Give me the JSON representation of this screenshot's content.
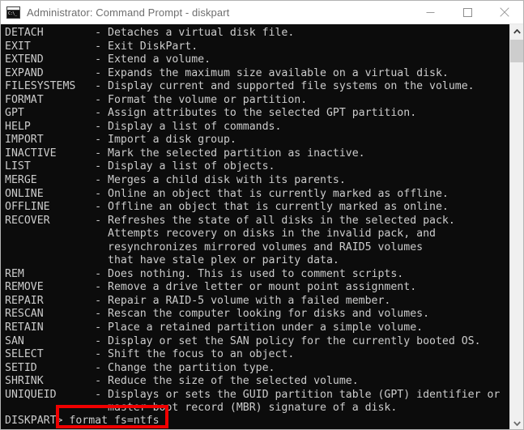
{
  "window": {
    "title": "Administrator: Command Prompt - diskpart",
    "icon": "command-prompt-icon",
    "icon_glyph": "C:\\_",
    "background_color": "#0c0c0c",
    "text_color": "#cccccc",
    "titlebar_color": "#ffffff"
  },
  "titlebar": {
    "minimize_label": "Minimize",
    "maximize_label": "Maximize",
    "close_label": "Close"
  },
  "console": {
    "body": "DETACH        - Detaches a virtual disk file.\nEXIT          - Exit DiskPart.\nEXTEND        - Extend a volume.\nEXPAND        - Expands the maximum size available on a virtual disk.\nFILESYSTEMS   - Display current and supported file systems on the volume.\nFORMAT        - Format the volume or partition.\nGPT           - Assign attributes to the selected GPT partition.\nHELP          - Display a list of commands.\nIMPORT        - Import a disk group.\nINACTIVE      - Mark the selected partition as inactive.\nLIST          - Display a list of objects.\nMERGE         - Merges a child disk with its parents.\nONLINE        - Online an object that is currently marked as offline.\nOFFLINE       - Offline an object that is currently marked as online.\nRECOVER       - Refreshes the state of all disks in the selected pack.\n                Attempts recovery on disks in the invalid pack, and\n                resynchronizes mirrored volumes and RAID5 volumes\n                that have stale plex or parity data.\nREM           - Does nothing. This is used to comment scripts.\nREMOVE        - Remove a drive letter or mount point assignment.\nREPAIR        - Repair a RAID-5 volume with a failed member.\nRESCAN        - Rescan the computer looking for disks and volumes.\nRETAIN        - Place a retained partition under a simple volume.\nSAN           - Display or set the SAN policy for the currently booted OS.\nSELECT        - Shift the focus to an object.\nSETID         - Change the partition type.\nSHRINK        - Reduce the size of the selected volume.\nUNIQUEID      - Displays or sets the GUID partition table (GPT) identifier or\n                master boot record (MBR) signature of a disk.",
    "prompt": "DISKPART> ",
    "command": "format fs=ntfs"
  },
  "annotation": {
    "highlight_color": "#f00000",
    "highlight_target": "format fs=ntfs"
  },
  "scrollbar": {
    "up_arrow": "chevron-up-icon",
    "down_arrow": "chevron-down-icon",
    "thumb_position_percent": 4
  }
}
